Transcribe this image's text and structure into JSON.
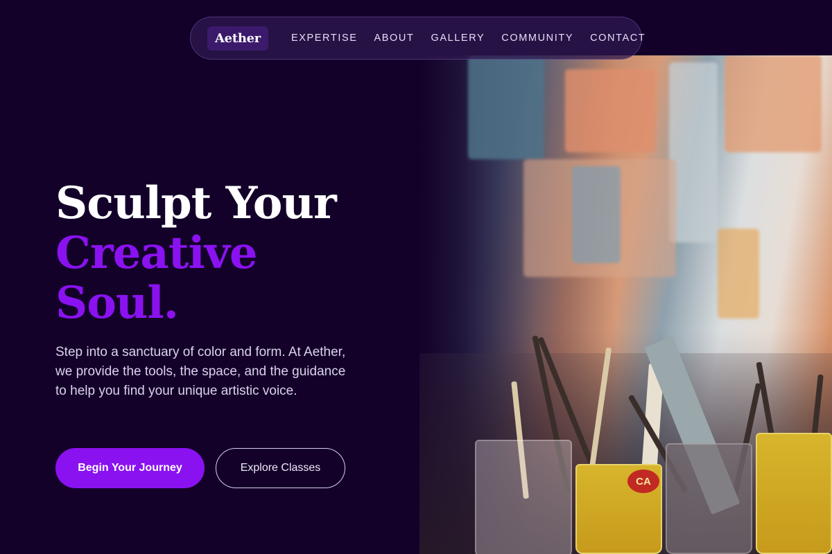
{
  "nav": {
    "logo": "Aether",
    "links": [
      "EXPERTISE",
      "ABOUT",
      "GALLERY",
      "COMMUNITY",
      "CONTACT"
    ]
  },
  "hero": {
    "title_line1": "Sculpt Your",
    "title_line2": "Creative",
    "title_line3": "Soul.",
    "description": "Step into a sanctuary of color and form. At Aether, we provide the tools, the space, and the guidance to help you find your unique artistic voice.",
    "primary_button": "Begin Your Journey",
    "secondary_button": "Explore Classes"
  },
  "colors": {
    "background": "#13012a",
    "accent": "#8a12f0",
    "text_light": "#dcd3ec"
  }
}
